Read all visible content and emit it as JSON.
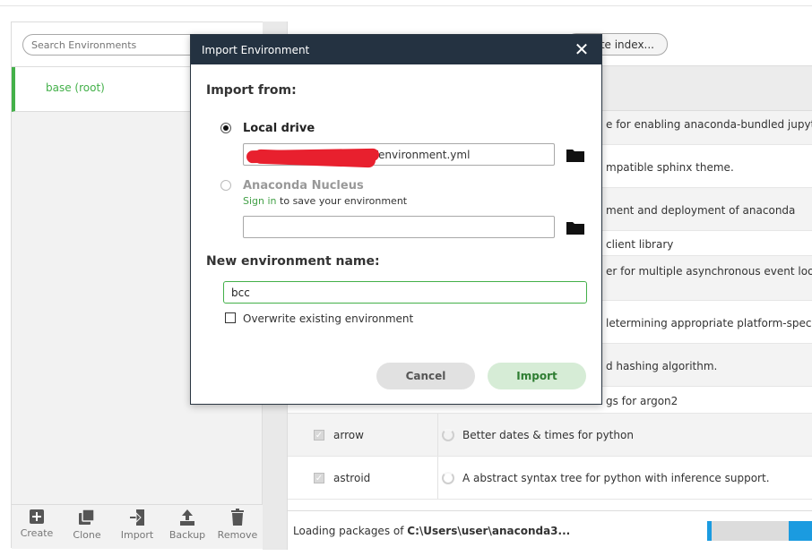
{
  "left_panel": {
    "search_placeholder": "Search Environments",
    "environments": [
      {
        "label": "base (root)"
      }
    ],
    "toolbar": [
      {
        "label": "Create",
        "icon": "plus-square-icon"
      },
      {
        "label": "Clone",
        "icon": "clone-icon"
      },
      {
        "label": "Import",
        "icon": "import-icon"
      },
      {
        "label": "Backup",
        "icon": "upload-icon"
      },
      {
        "label": "Remove",
        "icon": "trash-icon"
      }
    ]
  },
  "right_panel": {
    "update_index_label": "te index...",
    "packages": [
      {
        "name": "",
        "description": "e for enabling anaconda-bundled jupyter e"
      },
      {
        "name": "",
        "description": "mpatible sphinx theme."
      },
      {
        "name": "",
        "description": "ment and deployment of anaconda"
      },
      {
        "name": "",
        "description": "client library"
      },
      {
        "name": "",
        "description": "er for multiple asynchronous event loop"
      },
      {
        "name": "",
        "description": "letermining appropriate platform-specific"
      },
      {
        "name": "",
        "description": "d hashing algorithm."
      },
      {
        "name": "",
        "description": "gs for argon2"
      },
      {
        "name": "arrow",
        "description": "Better dates & times for python"
      },
      {
        "name": "astroid",
        "description": "A abstract syntax tree for python with inference support."
      }
    ],
    "status": {
      "prefix": "Loading packages of ",
      "path": "C:\\Users\\user\\anaconda3..."
    }
  },
  "dialog": {
    "title": "Import Environment",
    "close_icon": "close-icon",
    "import_from_heading": "Import from:",
    "local_drive_label": "Local drive",
    "local_drive_path": "/environment.yml",
    "nucleus_label": "Anaconda Nucleus",
    "sign_in_link": "Sign in",
    "sign_in_suffix": " to save your environment",
    "nucleus_path": "",
    "new_env_heading": "New environment name:",
    "env_name_value": "bcc",
    "overwrite_label": "Overwrite existing environment",
    "cancel_label": "Cancel",
    "import_label": "Import"
  },
  "colors": {
    "accent": "#43b049",
    "dialog_header": "#243241",
    "progress": "#1b9be0"
  }
}
